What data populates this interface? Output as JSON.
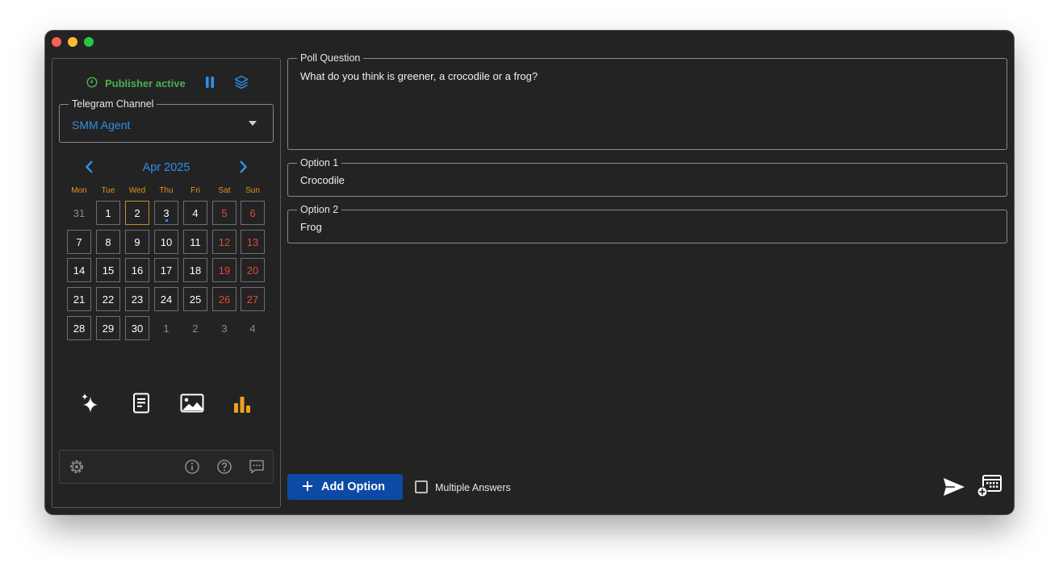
{
  "window": {
    "traffic_lights": [
      "close",
      "minimize",
      "zoom"
    ]
  },
  "sidebar": {
    "status": {
      "text": "Publisher active",
      "color": "#4caf50",
      "icon": "clock-icon"
    },
    "actions": [
      "pause-icon",
      "layers-icon"
    ],
    "channel": {
      "legend": "Telegram Channel",
      "value": "SMM Agent"
    },
    "calendar": {
      "month": "Apr 2025",
      "weekdays": [
        "Mon",
        "Tue",
        "Wed",
        "Thu",
        "Fri",
        "Sat",
        "Sun"
      ],
      "weeks": [
        [
          "31",
          "1",
          "2",
          "3",
          "4",
          "5",
          "6"
        ],
        [
          "7",
          "8",
          "9",
          "10",
          "11",
          "12",
          "13"
        ],
        [
          "14",
          "15",
          "16",
          "17",
          "18",
          "19",
          "20"
        ],
        [
          "21",
          "22",
          "23",
          "24",
          "25",
          "26",
          "27"
        ],
        [
          "28",
          "29",
          "30",
          "1",
          "2",
          "3",
          "4"
        ]
      ],
      "today": "2",
      "marked": "3"
    },
    "modes": [
      "sparkles-icon",
      "document-icon",
      "image-icon",
      "bar-chart-icon"
    ],
    "active_mode": "bar-chart-icon",
    "footer_icons": [
      "settings-icon",
      "info-icon",
      "help-icon",
      "chat-icon"
    ]
  },
  "poll": {
    "question_legend": "Poll Question",
    "question": "What do you think is greener, a crocodile or a frog?",
    "options": [
      {
        "legend": "Option 1",
        "value": "Crocodile"
      },
      {
        "legend": "Option 2",
        "value": "Frog"
      }
    ],
    "add_option_label": "Add Option",
    "multiple_answers_label": "Multiple Answers",
    "multiple_answers_checked": false
  },
  "colors": {
    "accent": "#2f8fe6",
    "weekend": "#e04a3c",
    "weekday_header": "#e8921c",
    "button": "#0d4aa6"
  }
}
